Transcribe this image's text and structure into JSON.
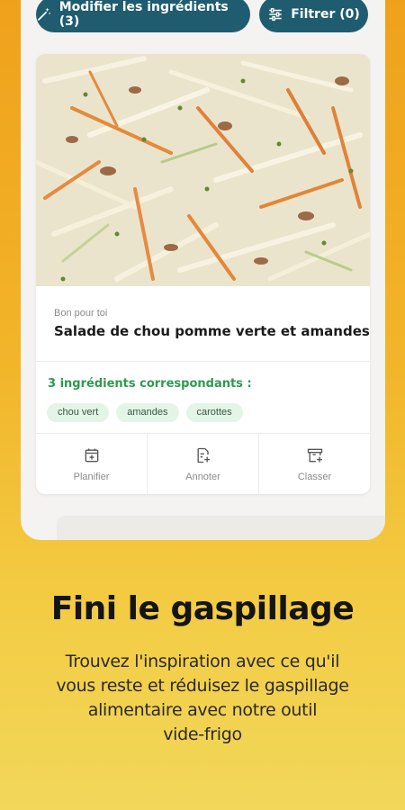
{
  "toolbar": {
    "modify_label": "Modifier les ingrédients (3)",
    "filter_label": "Filtrer (0)",
    "modify_icon": "magic-wand-icon",
    "filter_icon": "sliders-icon"
  },
  "recipe": {
    "subtitle": "Bon pour toi",
    "title": "Salade de chou pomme verte et amandes",
    "image": "coleslaw-photo",
    "match_label": "3 ingrédients correspondants :",
    "ingredients": [
      "chou vert",
      "amandes",
      "carottes"
    ]
  },
  "actions": [
    {
      "label": "Planifier",
      "icon": "calendar-plus-icon"
    },
    {
      "label": "Annoter",
      "icon": "note-add-icon"
    },
    {
      "label": "Classer",
      "icon": "archive-add-icon"
    }
  ],
  "promo": {
    "headline": "Fini le gaspillage",
    "body": "Trouvez l'inspiration avec ce qu'il\nvous reste et réduisez le gaspillage\nalimentaire avec notre outil\nvide-frigo"
  },
  "colors": {
    "primary": "#1f5c70",
    "accent_green": "#2e9a4f",
    "tag_bg": "#e3f5e6",
    "bg_top": "#f0a11c",
    "bg_bottom": "#f2d75a"
  }
}
